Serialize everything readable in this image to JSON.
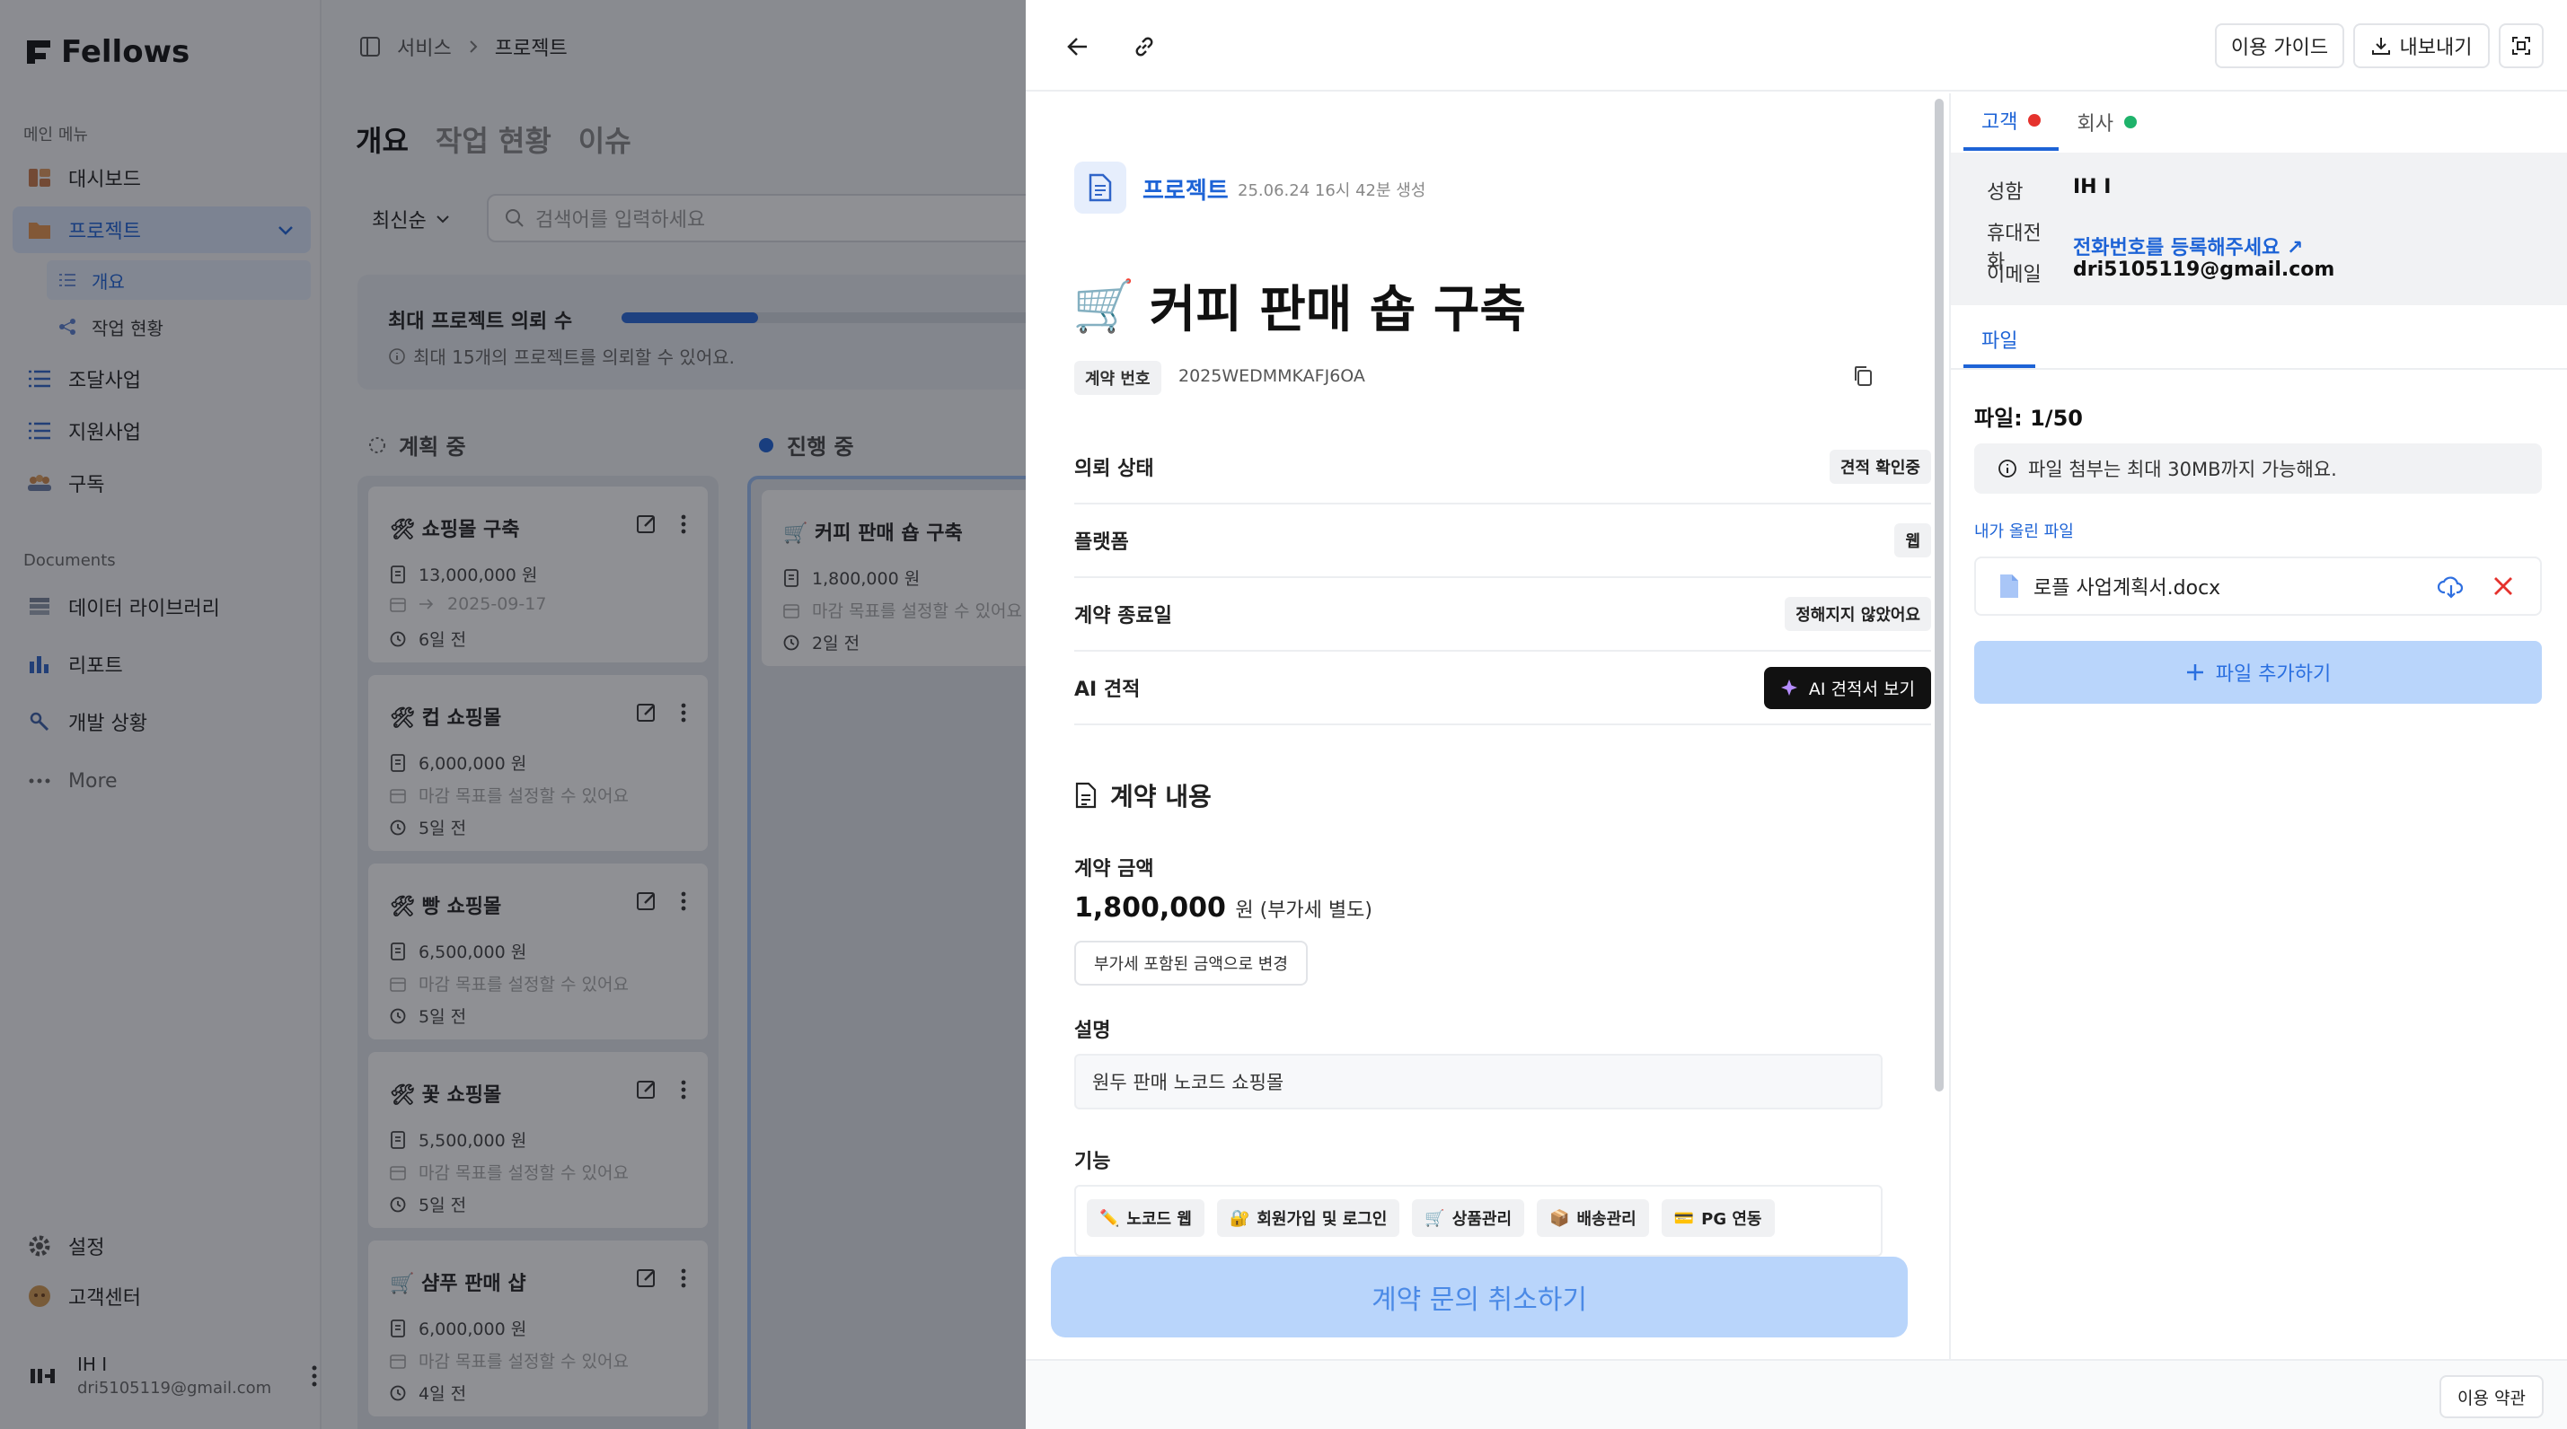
{
  "sidebar": {
    "logo": "Fellows",
    "main_menu_title": "메인 메뉴",
    "items": [
      {
        "label": "대시보드"
      },
      {
        "label": "프로젝트"
      },
      {
        "label": "조달사업"
      },
      {
        "label": "지원사업"
      },
      {
        "label": "구독"
      }
    ],
    "sub_items": [
      {
        "label": "개요"
      },
      {
        "label": "작업 현황"
      }
    ],
    "documents_title": "Documents",
    "doc_items": [
      {
        "label": "데이터 라이브러리"
      },
      {
        "label": "리포트"
      },
      {
        "label": "개발 상황"
      }
    ],
    "more_label": "More",
    "bottom_items": [
      {
        "label": "설정"
      },
      {
        "label": "고객센터"
      }
    ],
    "user": {
      "name": "IH I",
      "email": "dri5105119@gmail.com"
    }
  },
  "main": {
    "breadcrumb": [
      "서비스",
      "프로젝트"
    ],
    "tabs": [
      "개요",
      "작업 현황",
      "이슈"
    ],
    "sort_label": "최신순",
    "search_placeholder": "검색어를 입력하세요",
    "quota": {
      "title": "최대 프로젝트 의뢰 수",
      "note": "최대 15개의 프로젝트를 의뢰할 수 있어요.",
      "used": 3,
      "max": 15
    },
    "columns": [
      {
        "title": "계획 중",
        "cards": [
          {
            "icon": "🛠",
            "title": "쇼핑몰 구축",
            "price": "13,000,000 원",
            "deadline": "2025-09-17",
            "age": "6일 전"
          },
          {
            "icon": "🛠",
            "title": "컵 쇼핑몰",
            "price": "6,000,000 원",
            "deadline": "마감 목표를 설정할 수 있어요",
            "age": "5일 전"
          },
          {
            "icon": "🛠",
            "title": "빵 쇼핑몰",
            "price": "6,500,000 원",
            "deadline": "마감 목표를 설정할 수 있어요",
            "age": "5일 전"
          },
          {
            "icon": "🛠",
            "title": "꽃 쇼핑몰",
            "price": "5,500,000 원",
            "deadline": "마감 목표를 설정할 수 있어요",
            "age": "5일 전"
          },
          {
            "icon": "🛒",
            "title": "샴푸 판매 샵",
            "price": "6,000,000 원",
            "deadline": "마감 목표를 설정할 수 있어요",
            "age": "4일 전"
          }
        ]
      },
      {
        "title": "진행 중",
        "cards": [
          {
            "icon": "🛒",
            "title": "커피 판매 숍 구축",
            "price": "1,800,000 원",
            "deadline": "마감 목표를 설정할 수 있어요",
            "age": "2일 전"
          }
        ]
      }
    ]
  },
  "drawer": {
    "guide_label": "이용 가이드",
    "export_label": "내보내기",
    "project_link": "프로젝트",
    "created": "25.06.24 16시 42분 생성",
    "title_icon": "🛒",
    "title": "커피 판매 숍 구축",
    "contract_no_label": "계약 번호",
    "contract_no": "2025WEDMMKAFJ6OA",
    "props": [
      {
        "key": "의뢰 상태",
        "value": "견적 확인중"
      },
      {
        "key": "플랫폼",
        "value": "웹"
      },
      {
        "key": "계약 종료일",
        "value": "정해지지 않았어요"
      },
      {
        "key": "AI 견적",
        "value": "AI 견적서 보기"
      }
    ],
    "contract_section": "계약 내용",
    "amount_label": "계약 금액",
    "amount": "1,800,000",
    "amount_unit": "원 (부가세 별도)",
    "vat_button": "부가세 포함된 금액으로 변경",
    "desc_label": "설명",
    "desc": "원두 판매 노코드 쇼핑몰",
    "features_label": "기능",
    "features": [
      {
        "icon": "✏️",
        "label": "노코드 웹"
      },
      {
        "icon": "🔐",
        "label": "회원가입 및 로그인"
      },
      {
        "icon": "🛒",
        "label": "상품관리"
      },
      {
        "icon": "📦",
        "label": "배송관리"
      },
      {
        "icon": "💳",
        "label": "PG 연동"
      }
    ],
    "cancel_button": "계약 문의 취소하기",
    "terms_button": "이용 약관",
    "right": {
      "tabs": [
        {
          "label": "고객",
          "dot_color": "#e5322d"
        },
        {
          "label": "회사",
          "dot_color": "#1fb36b"
        }
      ],
      "info": [
        {
          "key": "성함",
          "value": "IH I"
        },
        {
          "key": "휴대전화",
          "value": "전화번호를 등록해주세요 ↗"
        },
        {
          "key": "이메일",
          "value": "dri5105119@gmail.com"
        }
      ],
      "file_tab": "파일",
      "file_count": "파일: 1/50",
      "file_note": "파일 첨부는 최대 30MB까지 가능해요.",
      "my_files_label": "내가 올린 파일",
      "files": [
        {
          "name": "로플 사업계획서.docx"
        }
      ],
      "add_file_button": "파일 추가하기"
    }
  },
  "colors": {
    "accent": "#1d63d6",
    "cancel_bg": "#b9d5fb",
    "red": "#e5322d",
    "green": "#1fb36b"
  }
}
